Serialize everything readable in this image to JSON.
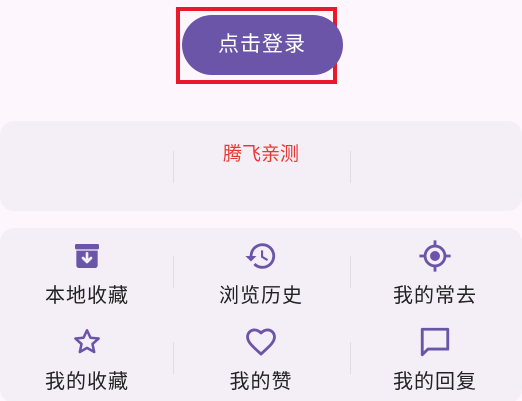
{
  "login": {
    "button_label": "点击登录"
  },
  "stats": {
    "title": "腾飞亲测"
  },
  "menu": {
    "items": [
      {
        "label": "本地收藏",
        "icon": "archive-download-icon"
      },
      {
        "label": "浏览历史",
        "icon": "history-icon"
      },
      {
        "label": "我的常去",
        "icon": "gps-target-icon"
      },
      {
        "label": "我的收藏",
        "icon": "star-outline-icon"
      },
      {
        "label": "我的赞",
        "icon": "heart-outline-icon"
      },
      {
        "label": "我的回复",
        "icon": "comment-icon"
      }
    ]
  },
  "colors": {
    "accent": "#6a55a8",
    "highlight_border": "#e8192b",
    "stats_title": "#e53935",
    "card_background": "#f4eef7",
    "page_background": "#fdf7fd"
  }
}
